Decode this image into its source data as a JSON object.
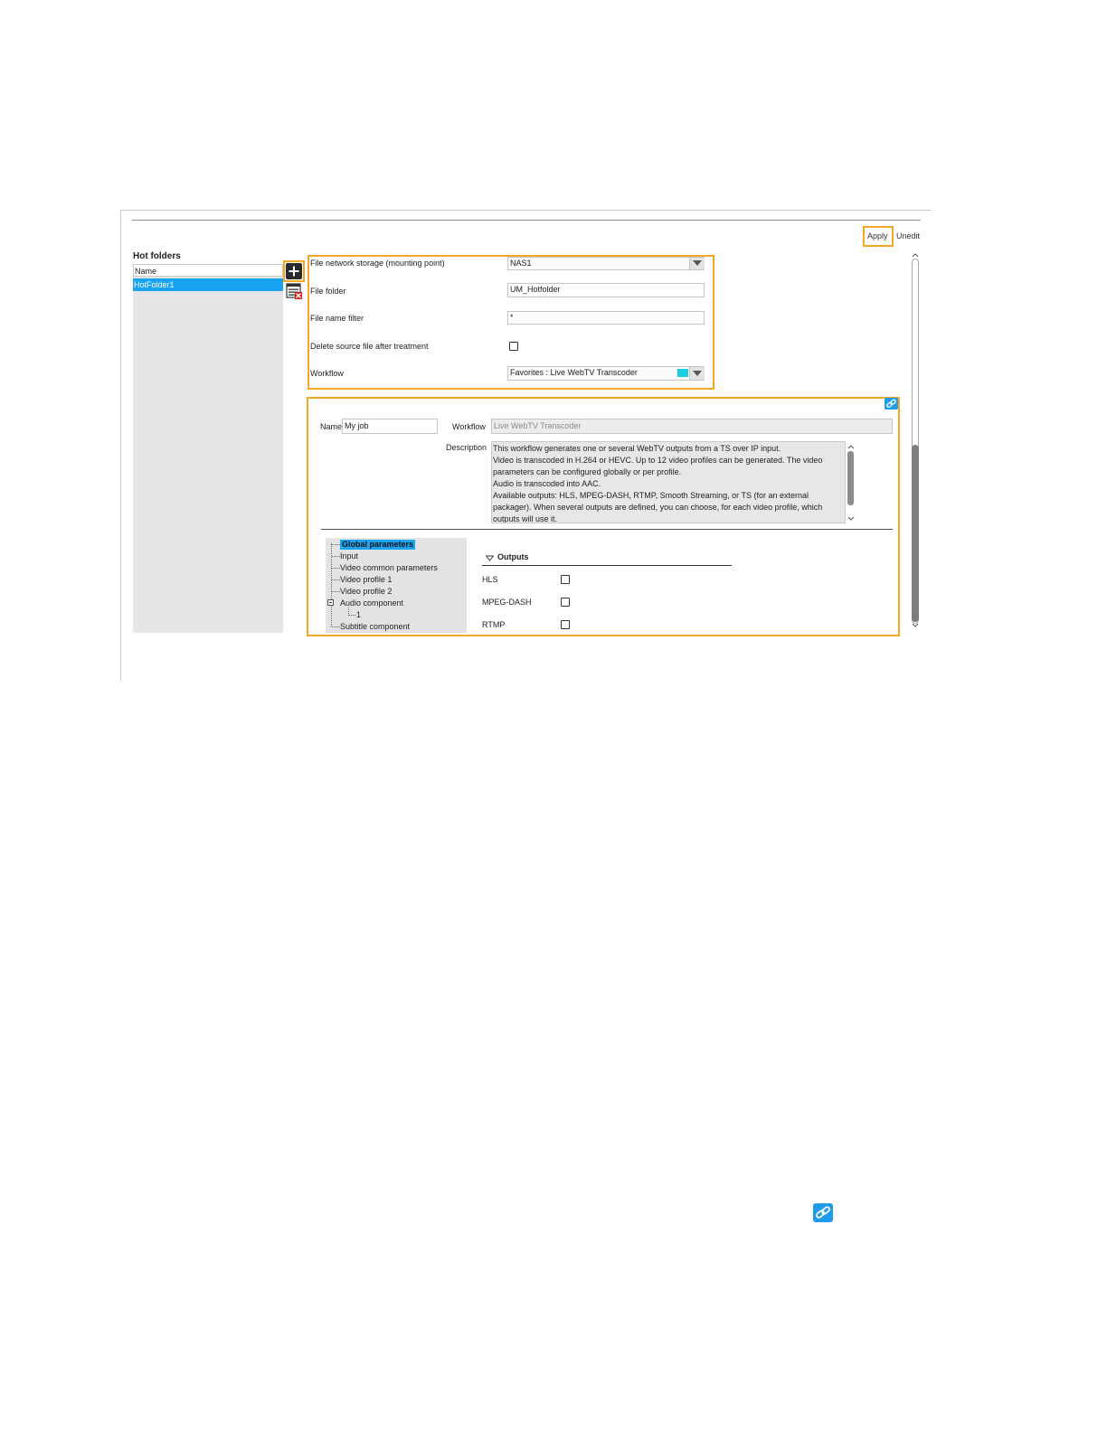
{
  "toolbar": {
    "apply_label": "Apply",
    "unedit_label": "Unedit"
  },
  "hot_folders": {
    "title": "Hot folders",
    "column_header": "Name",
    "items": [
      "HotFolder1"
    ]
  },
  "settings": {
    "storage_label": "File network storage (mounting point)",
    "storage_value": "NAS1",
    "folder_label": "File folder",
    "folder_value": "UM_Hotfolder",
    "filter_label": "File name filter",
    "filter_value": "*",
    "delete_label": "Delete source file after treatment",
    "delete_checked": false,
    "workflow_label": "Workflow",
    "workflow_value": "Favorites : Live WebTV Transcoder",
    "workflow_swatch_color": "#1ccfe0"
  },
  "job": {
    "name_label": "Name",
    "name_value": "My job",
    "workflow_label": "Workflow",
    "workflow_value": "Live WebTV Transcoder",
    "description_label": "Description",
    "description_lines": [
      "This workflow generates one or several WebTV outputs from a TS over IP input.",
      "Video is transcoded in H.264 or HEVC. Up to 12 video profiles can be generated. The video",
      "parameters can be configured globally or per profile.",
      "Audio is transcoded into AAC.",
      "Available outputs: HLS, MPEG-DASH, RTMP, Smooth Streaming, or TS (for an external",
      "packager). When several outputs are defined, you can choose, for each video profile, which",
      "outputs will use it."
    ]
  },
  "tree": {
    "items": [
      "Global parameters",
      "Input",
      "Video common parameters",
      "Video profile 1",
      "Video profile 2",
      "Audio component",
      "1",
      "Subtitle component"
    ],
    "selected_index": 0
  },
  "outputs": {
    "section_title": "Outputs",
    "items": [
      {
        "label": "HLS",
        "checked": false
      },
      {
        "label": "MPEG-DASH",
        "checked": false
      },
      {
        "label": "RTMP",
        "checked": false
      }
    ]
  },
  "colors": {
    "highlight_border": "#f5a623",
    "selection": "#1aa3f0",
    "link_icon": "#1e9be9"
  },
  "icons": {
    "add": "plus-icon",
    "delete": "delete-list-icon",
    "link": "link-icon"
  }
}
